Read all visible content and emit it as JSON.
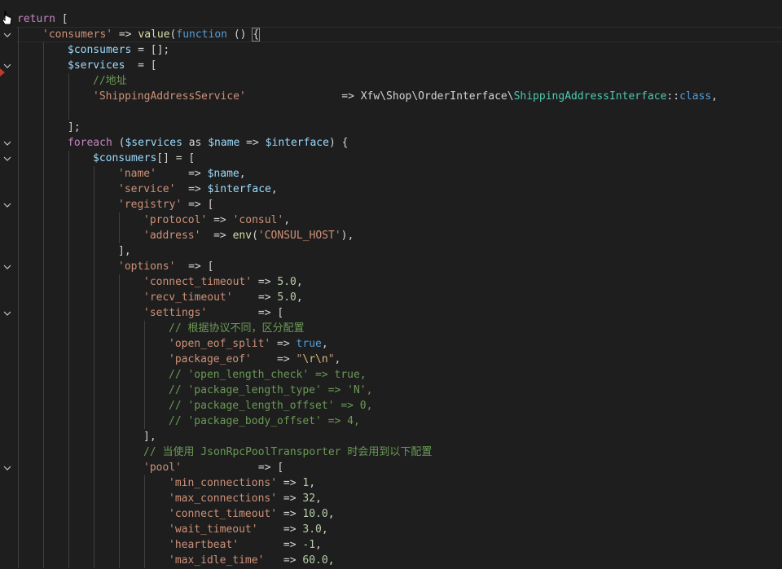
{
  "editor": {
    "language": "php",
    "lines": [
      [
        {
          "t": "return",
          "c": "c"
        },
        {
          "t": " [",
          "c": "p"
        }
      ],
      [
        {
          "t": "'consumers'",
          "c": "s"
        },
        {
          "t": " => ",
          "c": "p"
        },
        {
          "t": "value",
          "c": "f"
        },
        {
          "t": "(",
          "c": "p"
        },
        {
          "t": "function",
          "c": "k"
        },
        {
          "t": " () ",
          "c": "p"
        },
        {
          "t": "{",
          "c": "p"
        }
      ],
      [
        {
          "t": "$consumers",
          "c": "v"
        },
        {
          "t": " = [];",
          "c": "p"
        }
      ],
      [
        {
          "t": "$services",
          "c": "v"
        },
        {
          "t": "  = [",
          "c": "p"
        }
      ],
      [
        {
          "t": "//地址",
          "c": "cm"
        }
      ],
      [
        {
          "t": "'ShippingAddressService'",
          "c": "s"
        },
        {
          "t": "               => ",
          "c": "p"
        },
        {
          "t": "Xfw\\Shop\\OrderInterface\\",
          "c": "p"
        },
        {
          "t": "ShippingAddressInterface",
          "c": "t"
        },
        {
          "t": "::",
          "c": "p"
        },
        {
          "t": "class",
          "c": "k"
        },
        {
          "t": ",",
          "c": "p"
        }
      ],
      [],
      [
        {
          "t": "];",
          "c": "p"
        }
      ],
      [
        {
          "t": "foreach",
          "c": "c"
        },
        {
          "t": " (",
          "c": "p"
        },
        {
          "t": "$services",
          "c": "v"
        },
        {
          "t": " as ",
          "c": "p"
        },
        {
          "t": "$name",
          "c": "v"
        },
        {
          "t": " => ",
          "c": "p"
        },
        {
          "t": "$interface",
          "c": "v"
        },
        {
          "t": ") {",
          "c": "p"
        }
      ],
      [
        {
          "t": "$consumers",
          "c": "v"
        },
        {
          "t": "[] = [",
          "c": "p"
        }
      ],
      [
        {
          "t": "'name'",
          "c": "s"
        },
        {
          "t": "     => ",
          "c": "p"
        },
        {
          "t": "$name",
          "c": "v"
        },
        {
          "t": ",",
          "c": "p"
        }
      ],
      [
        {
          "t": "'service'",
          "c": "s"
        },
        {
          "t": "  => ",
          "c": "p"
        },
        {
          "t": "$interface",
          "c": "v"
        },
        {
          "t": ",",
          "c": "p"
        }
      ],
      [
        {
          "t": "'registry'",
          "c": "s"
        },
        {
          "t": " => [",
          "c": "p"
        }
      ],
      [
        {
          "t": "'protocol'",
          "c": "s"
        },
        {
          "t": " => ",
          "c": "p"
        },
        {
          "t": "'consul'",
          "c": "s"
        },
        {
          "t": ",",
          "c": "p"
        }
      ],
      [
        {
          "t": "'address'",
          "c": "s"
        },
        {
          "t": "  => ",
          "c": "p"
        },
        {
          "t": "env",
          "c": "f"
        },
        {
          "t": "(",
          "c": "p"
        },
        {
          "t": "'CONSUL_HOST'",
          "c": "s"
        },
        {
          "t": "),",
          "c": "p"
        }
      ],
      [
        {
          "t": "],",
          "c": "p"
        }
      ],
      [
        {
          "t": "'options'",
          "c": "s"
        },
        {
          "t": "  => [",
          "c": "p"
        }
      ],
      [
        {
          "t": "'connect_timeout'",
          "c": "s"
        },
        {
          "t": " => ",
          "c": "p"
        },
        {
          "t": "5.0",
          "c": "n"
        },
        {
          "t": ",",
          "c": "p"
        }
      ],
      [
        {
          "t": "'recv_timeout'",
          "c": "s"
        },
        {
          "t": "    => ",
          "c": "p"
        },
        {
          "t": "5.0",
          "c": "n"
        },
        {
          "t": ",",
          "c": "p"
        }
      ],
      [
        {
          "t": "'settings'",
          "c": "s"
        },
        {
          "t": "        => [",
          "c": "p"
        }
      ],
      [
        {
          "t": "// 根据协议不同，区分配置",
          "c": "cm"
        }
      ],
      [
        {
          "t": "'open_eof_split'",
          "c": "s"
        },
        {
          "t": " => ",
          "c": "p"
        },
        {
          "t": "true",
          "c": "k"
        },
        {
          "t": ",",
          "c": "p"
        }
      ],
      [
        {
          "t": "'package_eof'",
          "c": "s"
        },
        {
          "t": "    => ",
          "c": "p"
        },
        {
          "t": "\"",
          "c": "s"
        },
        {
          "t": "\\r\\n",
          "c": "e"
        },
        {
          "t": "\"",
          "c": "s"
        },
        {
          "t": ",",
          "c": "p"
        }
      ],
      [
        {
          "t": "// 'open_length_check' => true,",
          "c": "cm"
        }
      ],
      [
        {
          "t": "// 'package_length_type' => 'N',",
          "c": "cm"
        }
      ],
      [
        {
          "t": "// 'package_length_offset' => 0,",
          "c": "cm"
        }
      ],
      [
        {
          "t": "// 'package_body_offset' => 4,",
          "c": "cm"
        }
      ],
      [
        {
          "t": "],",
          "c": "p"
        }
      ],
      [
        {
          "t": "// 当使用 JsonRpcPoolTransporter 时会用到以下配置",
          "c": "cm"
        }
      ],
      [
        {
          "t": "'pool'",
          "c": "s"
        },
        {
          "t": "            => [",
          "c": "p"
        }
      ],
      [
        {
          "t": "'min_connections'",
          "c": "s"
        },
        {
          "t": " => ",
          "c": "p"
        },
        {
          "t": "1",
          "c": "n"
        },
        {
          "t": ",",
          "c": "p"
        }
      ],
      [
        {
          "t": "'max_connections'",
          "c": "s"
        },
        {
          "t": " => ",
          "c": "p"
        },
        {
          "t": "32",
          "c": "n"
        },
        {
          "t": ",",
          "c": "p"
        }
      ],
      [
        {
          "t": "'connect_timeout'",
          "c": "s"
        },
        {
          "t": " => ",
          "c": "p"
        },
        {
          "t": "10.0",
          "c": "n"
        },
        {
          "t": ",",
          "c": "p"
        }
      ],
      [
        {
          "t": "'wait_timeout'",
          "c": "s"
        },
        {
          "t": "    => ",
          "c": "p"
        },
        {
          "t": "3.0",
          "c": "n"
        },
        {
          "t": ",",
          "c": "p"
        }
      ],
      [
        {
          "t": "'heartbeat'",
          "c": "s"
        },
        {
          "t": "       => ",
          "c": "p"
        },
        {
          "t": "-1",
          "c": "n"
        },
        {
          "t": ",",
          "c": "p"
        }
      ],
      [
        {
          "t": "'max_idle_time'",
          "c": "s"
        },
        {
          "t": "   => ",
          "c": "p"
        },
        {
          "t": "60.0",
          "c": "n"
        },
        {
          "t": ",",
          "c": "p"
        }
      ]
    ]
  }
}
